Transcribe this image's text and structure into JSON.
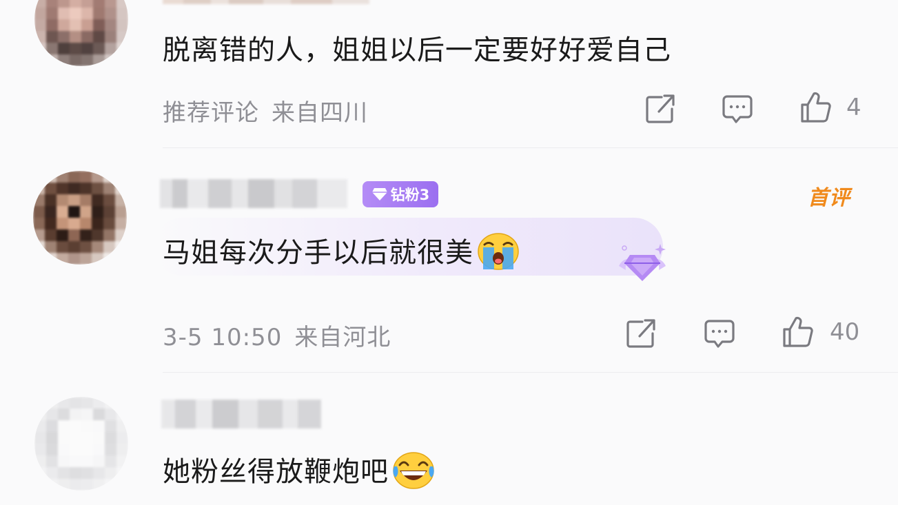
{
  "comments": [
    {
      "text": "脱离错的人，姐姐以后一定要好好爱自己",
      "meta_label": "推荐评论",
      "location": "来自四川",
      "likes": "4"
    },
    {
      "badge": "钻粉3",
      "first_tag": "首评",
      "text": "马姐每次分手以后就很美",
      "emoji": "crying-face-emoji",
      "timestamp": "3-5 10:50",
      "location": "来自河北",
      "likes": "40"
    },
    {
      "text": "她粉丝得放鞭炮吧",
      "emoji": "laughing-tears-emoji"
    }
  ],
  "icons": {
    "share": "share-icon",
    "reply": "comment-icon",
    "like": "thumbs-up-icon"
  },
  "colors": {
    "meta_gray": "#8f8f95",
    "badge_purple": "#a57cf3",
    "first_tag_orange": "#f08a1c"
  }
}
